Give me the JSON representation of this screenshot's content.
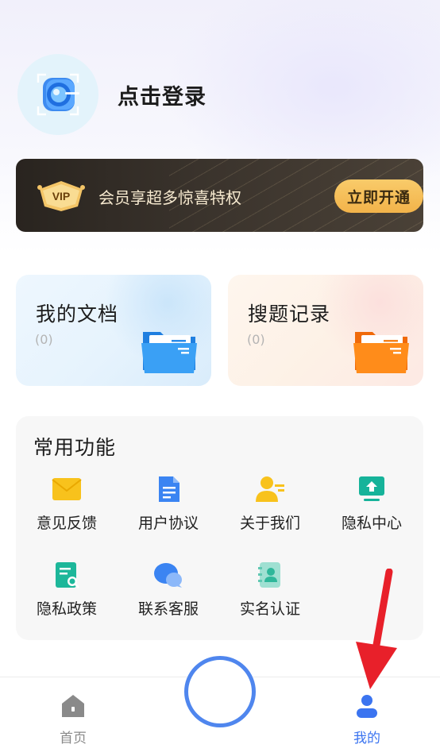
{
  "header": {
    "login_label": "点击登录"
  },
  "vip": {
    "badge_text": "VIP",
    "promo_text": "会员享超多惊喜特权",
    "button_label": "立即开通"
  },
  "cards": [
    {
      "title": "我的文档",
      "count": "(0)"
    },
    {
      "title": "搜题记录",
      "count": "(0)"
    }
  ],
  "features": {
    "title": "常用功能",
    "items": [
      {
        "label": "意见反馈",
        "icon": "envelope-icon"
      },
      {
        "label": "用户协议",
        "icon": "document-icon"
      },
      {
        "label": "关于我们",
        "icon": "person-card-icon"
      },
      {
        "label": "隐私中心",
        "icon": "monitor-upload-icon"
      },
      {
        "label": "隐私政策",
        "icon": "document-search-icon"
      },
      {
        "label": "联系客服",
        "icon": "chat-bubbles-icon"
      },
      {
        "label": "实名认证",
        "icon": "contact-book-icon"
      }
    ]
  },
  "bottom_nav": {
    "items": [
      {
        "label": "首页",
        "icon": "home-icon",
        "active": false
      },
      {
        "label": "我的",
        "icon": "user-icon",
        "active": true
      }
    ]
  },
  "colors": {
    "accent_blue": "#4f86ee",
    "vip_gold": "#f2b34a",
    "annotation_red": "#e8202a"
  }
}
